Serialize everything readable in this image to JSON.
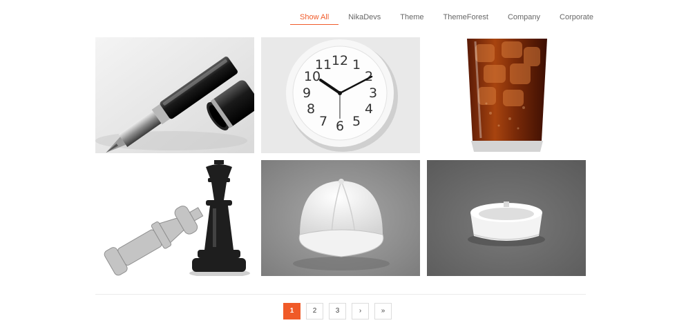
{
  "filters": {
    "items": [
      {
        "label": "Show All",
        "active": true
      },
      {
        "label": "NikaDevs",
        "active": false
      },
      {
        "label": "Theme",
        "active": false
      },
      {
        "label": "ThemeForest",
        "active": false
      },
      {
        "label": "Company",
        "active": false
      },
      {
        "label": "Corporate",
        "active": false
      }
    ]
  },
  "portfolio": {
    "items": [
      {
        "subject": "fountain-pen"
      },
      {
        "subject": "wall-clock"
      },
      {
        "subject": "cola-glass"
      },
      {
        "subject": "chess-pieces"
      },
      {
        "subject": "baseball-cap"
      },
      {
        "subject": "ashtray"
      }
    ]
  },
  "pagination": {
    "pages": [
      "1",
      "2",
      "3"
    ],
    "current": "1",
    "next": "›",
    "last": "»"
  },
  "colors": {
    "accent": "#f05a28",
    "text": "#666666"
  }
}
